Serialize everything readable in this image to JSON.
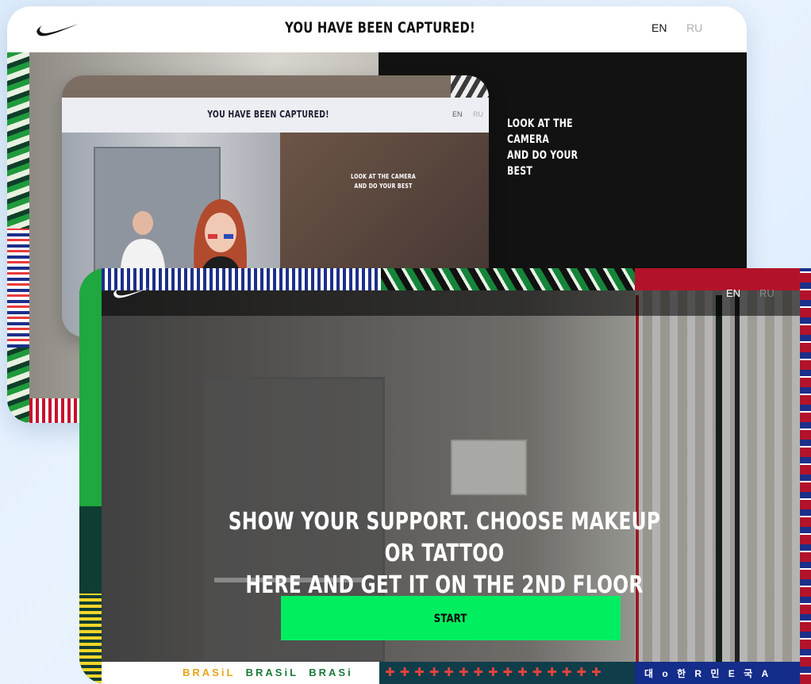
{
  "back_screen": {
    "title": "YOU HAVE BEEN CAPTURED!",
    "lang_en": "EN",
    "lang_ru": "RU",
    "instruction_line1": "LOOK AT THE CAMERA",
    "instruction_line2": "AND DO YOUR BEST"
  },
  "photo_screen": {
    "title": "YOU HAVE BEEN CAPTURED!",
    "lang_en": "EN",
    "lang_ru": "RU",
    "instruction_line1": "LOOK AT THE CAMERA",
    "instruction_line2": "AND DO YOUR BEST"
  },
  "front_screen": {
    "lang_en": "EN",
    "lang_ru": "RU",
    "headline_line1": "SHOW YOUR SUPPORT. CHOOSE MAKEUP OR TATTOO",
    "headline_line2": "HERE AND GET IT ON THE 2ND FLOOR FOR FREE",
    "start_button": "START",
    "border_text_brasil_1": "BRASiL",
    "border_text_brasil_2": "BRASiL",
    "border_text_brasil_3": "BRASi",
    "border_text_korea": "대 o 한 R 민 E 국 A"
  },
  "colors": {
    "start_button": "#00ee60",
    "background": "#e3effc"
  }
}
